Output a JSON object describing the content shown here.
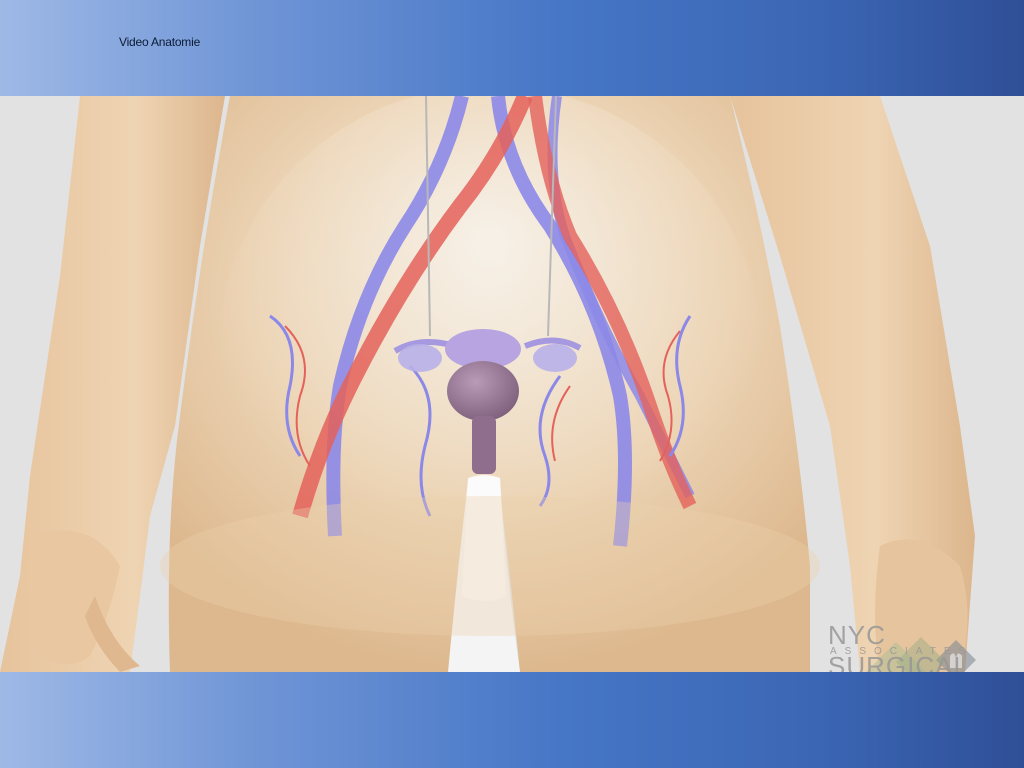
{
  "slide": {
    "title": "Video Anatomie"
  },
  "video": {
    "watermark_logo_icon": "lungs-diamond-logo-icon",
    "watermark_main": "NYC SURGICAL",
    "watermark_sub": "ASSOCIATES"
  },
  "colors": {
    "band_light": "#9fb9e6",
    "band_dark": "#2f4f97",
    "skin": "#e9c9a3",
    "artery": "#e0605a",
    "vein": "#8a86e6",
    "uterus": "#9c7f9a"
  }
}
